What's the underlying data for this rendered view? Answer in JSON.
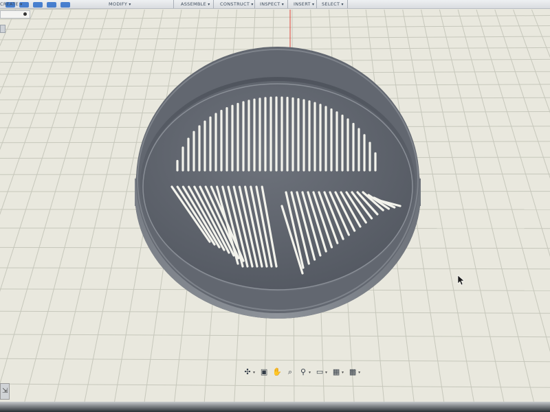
{
  "toolbar": {
    "menus": [
      {
        "label": "CREATE"
      },
      {
        "label": "MODIFY"
      },
      {
        "label": "ASSEMBLE"
      },
      {
        "label": "CONSTRUCT"
      },
      {
        "label": "INSPECT"
      },
      {
        "label": "INSERT"
      },
      {
        "label": "SELECT"
      }
    ]
  },
  "viewport": {
    "background": "#e9e8de",
    "grid_color": "#c9cabf",
    "model_color": "#5b6069",
    "axis_color": "#e0453a"
  },
  "navbar": {
    "icons": [
      "orbit-icon",
      "pan-icon",
      "hand-icon",
      "zoom-window-icon",
      "zoom-icon",
      "display-settings-icon",
      "grid-settings-icon",
      "viewports-icon"
    ]
  }
}
